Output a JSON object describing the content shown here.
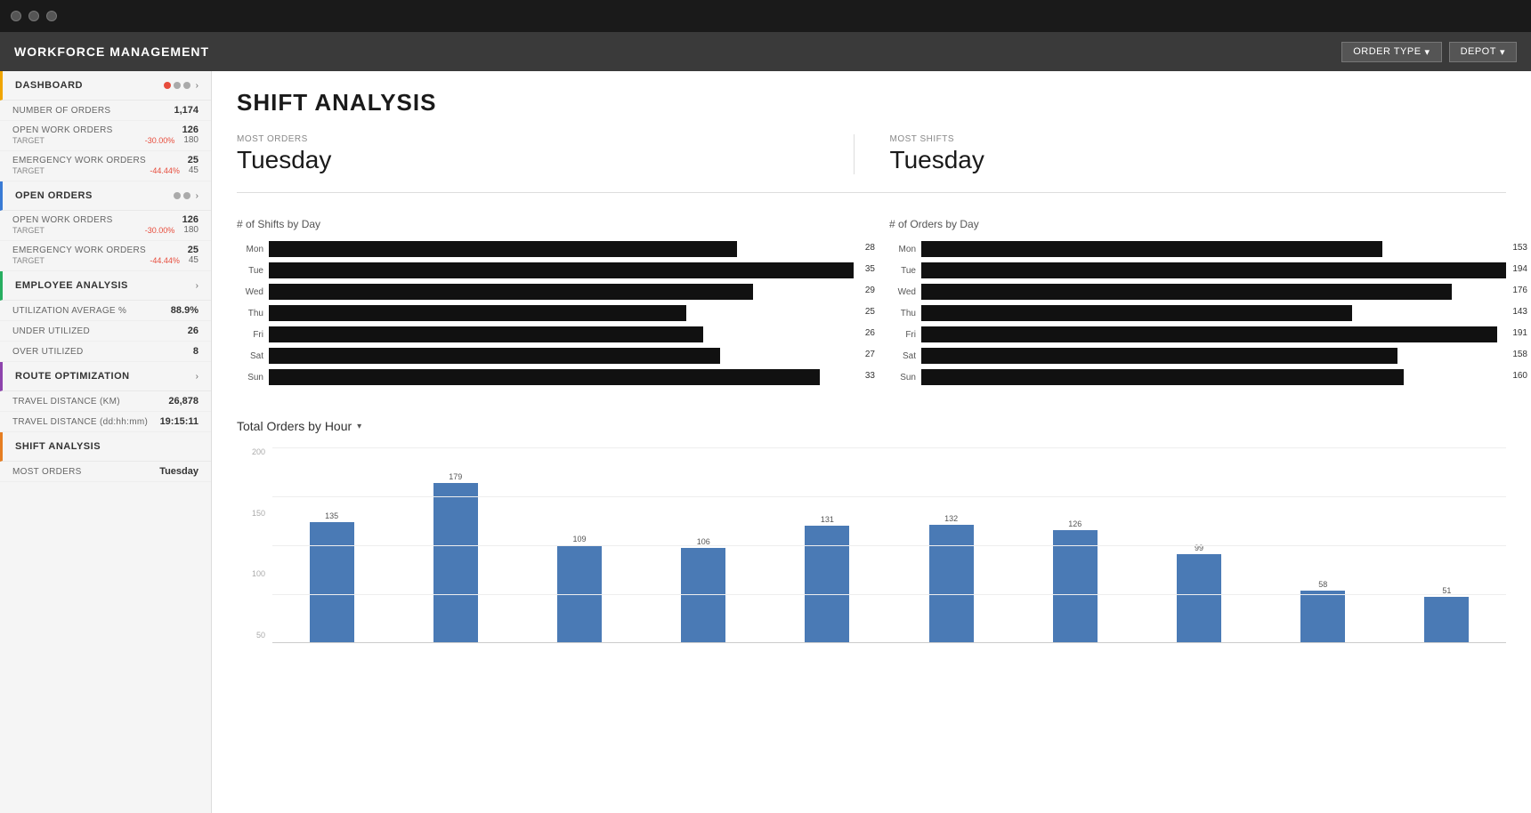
{
  "titleBar": {
    "circles": [
      "circle1",
      "circle2",
      "circle3"
    ]
  },
  "header": {
    "title": "WORKFORCE MANAGEMENT",
    "orderTypeBtn": "ORDER TYPE",
    "depotBtn": "DEPOT"
  },
  "sidebar": {
    "dashboard": {
      "label": "DASHBOARD",
      "chevron": "›"
    },
    "stats": [
      {
        "label": "NUMBER OF ORDERS",
        "value": "1,174"
      },
      {
        "label": "OPEN WORK ORDERS",
        "value": "126",
        "sub": "-30.00%",
        "target": "180",
        "targetLabel": "TARGET"
      },
      {
        "label": "EMERGENCY WORK ORDERS",
        "value": "25",
        "sub": "-44.44%",
        "target": "45",
        "targetLabel": "TARGET"
      }
    ],
    "openOrders": {
      "label": "OPEN ORDERS",
      "chevron": "›"
    },
    "openOrdersStats": [
      {
        "label": "OPEN WORK ORDERS",
        "value": "126",
        "sub": "-30.00%",
        "target": "180",
        "targetLabel": "TARGET"
      },
      {
        "label": "EMERGENCY WORK ORDERS",
        "value": "25",
        "sub": "-44.44%",
        "target": "45",
        "targetLabel": "TARGET"
      }
    ],
    "employeeAnalysis": {
      "label": "EMPLOYEE ANALYSIS",
      "chevron": "›"
    },
    "employeeStats": [
      {
        "label": "UTILIZATION AVERAGE %",
        "value": "88.9%"
      },
      {
        "label": "UNDER UTILIZED",
        "value": "26"
      },
      {
        "label": "OVER UTILIZED",
        "value": "8"
      }
    ],
    "routeOptimization": {
      "label": "ROUTE OPTIMIZATION",
      "chevron": "›"
    },
    "routeStats": [
      {
        "label": "TRAVEL DISTANCE (KM)",
        "value": "26,878"
      },
      {
        "label": "TRAVEL DISTANCE (dd:hh:mm)",
        "value": "19:15:11"
      }
    ],
    "shiftAnalysis": {
      "label": "SHIFT ANALYSIS"
    },
    "shiftStats": [
      {
        "label": "MOST ORDERS",
        "value": "Tuesday"
      }
    ]
  },
  "content": {
    "pageTitle": "SHIFT ANALYSIS",
    "mostOrders": {
      "subLabel": "MOST ORDERS",
      "value": "Tuesday"
    },
    "mostShifts": {
      "subLabel": "MOST SHIFTS",
      "value": "Tuesday"
    },
    "shiftsByDay": {
      "title": "# of Shifts by Day",
      "maxValue": 35,
      "bars": [
        {
          "label": "Mon",
          "value": 28
        },
        {
          "label": "Tue",
          "value": 35
        },
        {
          "label": "Wed",
          "value": 29
        },
        {
          "label": "Thu",
          "value": 25
        },
        {
          "label": "Fri",
          "value": 26
        },
        {
          "label": "Sat",
          "value": 27
        },
        {
          "label": "Sun",
          "value": 33
        }
      ]
    },
    "ordersByDay": {
      "title": "# of Orders by Day",
      "maxValue": 194,
      "bars": [
        {
          "label": "Mon",
          "value": 153
        },
        {
          "label": "Tue",
          "value": 194
        },
        {
          "label": "Wed",
          "value": 176
        },
        {
          "label": "Thu",
          "value": 143
        },
        {
          "label": "Fri",
          "value": 191
        },
        {
          "label": "Sat",
          "value": 158
        },
        {
          "label": "Sun",
          "value": 160
        }
      ]
    },
    "ordersByHour": {
      "title": "Total Orders by Hour",
      "yLabels": [
        "200",
        "150",
        "100",
        "50"
      ],
      "maxValue": 200,
      "bars": [
        {
          "value": 135
        },
        {
          "value": 179
        },
        {
          "value": 109
        },
        {
          "value": 106
        },
        {
          "value": 131
        },
        {
          "value": 132
        },
        {
          "value": 126
        },
        {
          "value": 99
        },
        {
          "value": 58
        },
        {
          "value": 51
        }
      ]
    }
  }
}
